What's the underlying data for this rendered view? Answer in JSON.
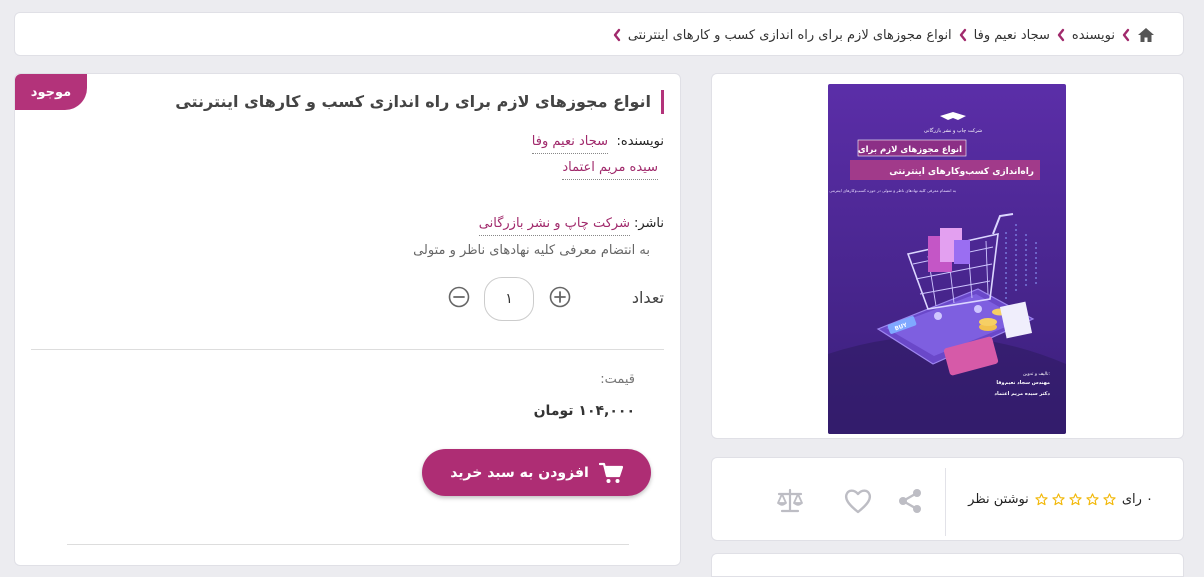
{
  "breadcrumb": {
    "items": [
      "نویسنده",
      "سجاد نعیم وفا",
      "انواع مجوزهای لازم برای راه اندازی کسب و کارهای اینترنتی"
    ]
  },
  "product": {
    "badge": "موجود",
    "title": "انواع مجوزهای لازم برای راه اندازی کسب و کارهای اینترنتی",
    "author_label": "نویسنده:",
    "authors": [
      "سجاد نعیم وفا",
      "سیده مریم اعتماد"
    ],
    "publisher_label": "ناشر:",
    "publisher": "شرکت چاپ و نشر بازرگانی",
    "subtitle": "به انتضام معرفی کلیه نهادهای ناظر و متولی",
    "quantity_label": "تعداد",
    "quantity": "۱",
    "price_label": "قیمت:",
    "price": "۱۰۴,۰۰۰ تومان",
    "add_to_cart": "افزودن به سبد خرید"
  },
  "rating": {
    "count_text": "۰ رای",
    "stars": 0,
    "max_stars": 5,
    "write_review": "نوشتن نظر"
  },
  "cover": {
    "publisher": "شرکت چاپ و نشر بازرگانی",
    "title_line1": "انواع مجوزهای لازم برای",
    "title_line2": "راه‌اندازی کسب‌وکارهای اینترنتی",
    "tagline": "به انضمام معرفی کلیه نهادهای ناظر و متولی در حوزه کسب‌وکارهای اینترنتی",
    "buy_tag": "BUY",
    "credits_label": "تالیف و تدوین:",
    "author1": "مهندس سجاد نعیم‌وفا",
    "author2": "دکتر سیده مریم اعتماد"
  },
  "colors": {
    "accent": "#b3337a",
    "link": "#a12a6c",
    "star": "#f2b705",
    "cover_bg": "#4a2a8c"
  }
}
